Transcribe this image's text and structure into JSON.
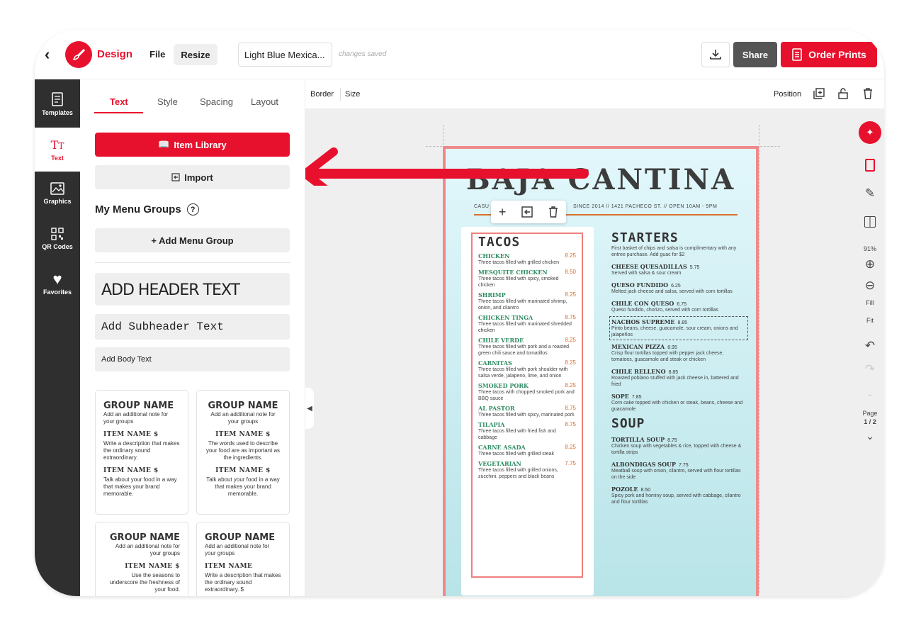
{
  "topbar": {
    "brand": "Design",
    "file": "File",
    "resize": "Resize",
    "doc_title": "Light Blue Mexica...",
    "saved": "changes saved",
    "share": "Share",
    "order": "Order Prints"
  },
  "rail": [
    {
      "label": "Templates",
      "icon": "templates-icon"
    },
    {
      "label": "Text",
      "icon": "text-icon"
    },
    {
      "label": "Graphics",
      "icon": "graphics-icon"
    },
    {
      "label": "QR Codes",
      "icon": "qr-code-icon"
    },
    {
      "label": "Favorites",
      "icon": "heart-icon"
    }
  ],
  "panel": {
    "tabs": [
      "Text",
      "Style",
      "Spacing",
      "Layout"
    ],
    "item_library": "Item Library",
    "import": "Import",
    "my_menu_groups": "My Menu Groups",
    "add_menu_group": "+ Add Menu Group",
    "add_header": "ADD HEADER TEXT",
    "add_subheader": "Add Subheader Text",
    "add_body": "Add Body Text",
    "cards": [
      {
        "group": "GROUP NAME",
        "note": "Add an additional note for your groups",
        "item1": "ITEM NAME $",
        "desc1": "Write a description that makes the ordinary sound extraordinary.",
        "item2": "ITEM NAME $",
        "desc2": "Talk about your food in a way that makes your brand memorable."
      },
      {
        "group": "GROUP NAME",
        "note": "Add an additional note for your groups",
        "item1": "ITEM NAME $",
        "desc1": "The words used to describe your food are as important as the ingredients.",
        "item2": "ITEM NAME $",
        "desc2": "Talk about your food in a way that makes your brand memorable."
      },
      {
        "group": "GROUP NAME",
        "note": "Add an additional note for your groups",
        "item1": "ITEM NAME $",
        "desc1": "Use the seasons to underscore the freshness of your food."
      },
      {
        "group": "GROUP NAME",
        "note": "Add an additional note for your groups",
        "item1": "ITEM NAME",
        "desc1": "Write a description that makes the ordinary sound extraordinary. $"
      }
    ]
  },
  "canvas_bar": {
    "border": "Border",
    "size": "Size",
    "position": "Position"
  },
  "menu": {
    "title": "BAJA CANTINA",
    "subtitle_left": "CASU",
    "subtitle_right": "SINCE 2014 // 1421 PACHECO ST. // OPEN 10AM - 9PM",
    "tacos_title": "TACOS",
    "tacos": [
      {
        "name": "CHICKEN",
        "price": "8.25",
        "desc": "Three tacos filled with grilled chicken"
      },
      {
        "name": "MESQUITE CHICKEN",
        "price": "8.50",
        "desc": "Three tacos filled with spicy, smoked chicken"
      },
      {
        "name": "SHRIMP",
        "price": "8.25",
        "desc": "Three tacos filled with marinated shrimp, onion, and cilantro"
      },
      {
        "name": "CHICKEN TINGA",
        "price": "8.75",
        "desc": "Three tacos filled with marinated shredded chicken"
      },
      {
        "name": "CHILE VERDE",
        "price": "8.25",
        "desc": "Three tacos filled with pork and a roasted green chili sauce and tomatillos"
      },
      {
        "name": "CARNITAS",
        "price": "8.25",
        "desc": "Three tacos filled with pork shoulder with salsa verde, jalapeno, lime, and onion"
      },
      {
        "name": "SMOKED PORK",
        "price": "8.25",
        "desc": "Three tacos with chopped smoked pork and BBQ sauce"
      },
      {
        "name": "AL PASTOR",
        "price": "8.75",
        "desc": "Three tacos filled with spicy, marinated pork"
      },
      {
        "name": "TILAPIA",
        "price": "8.75",
        "desc": "Three tacos filled with fried fish and cabbage"
      },
      {
        "name": "CARNE ASADA",
        "price": "8.25",
        "desc": "Three tacos filled with grilled steak"
      },
      {
        "name": "VEGETARIAN",
        "price": "7.75",
        "desc": "Three tacos filled with grilled onions, zucchini, peppers and black beans"
      }
    ],
    "starters_title": "STARTERS",
    "starters_note": "First basket of chips and salsa is complimentary with any entree purchase. Add guac for $2",
    "starters": [
      {
        "name": "CHEESE QUESADILLAS",
        "price": "5.75",
        "desc": "Served with salsa & sour cream"
      },
      {
        "name": "QUESO FUNDIDO",
        "price": "6.25",
        "desc": "Melted jack cheese and salsa, served with corn tortillas"
      },
      {
        "name": "CHILE CON QUESO",
        "price": "6.75",
        "desc": "Queso fundido, chorizo, served with corn tortillas"
      },
      {
        "name": "NACHOS SUPREME",
        "price": "8.85",
        "desc": "Pinto beans, cheese, guacamole, sour cream, onions and jalapeños"
      },
      {
        "name": "MEXICAN PIZZA",
        "price": "8.95",
        "desc": "Crisp flour tortillas topped with pepper jack cheese, tomatoes, guacamole and steak or chicken"
      },
      {
        "name": "CHILE RELLENO",
        "price": "8.85",
        "desc": "Roasted poblano stuffed with jack cheese in, battered and fried"
      },
      {
        "name": "SOPE",
        "price": "7.85",
        "desc": "Corn cake topped with chicken or steak, beans, cheese and guacamole"
      }
    ],
    "soup_title": "SOUP",
    "soups": [
      {
        "name": "TORTILLA SOUP",
        "price": "8.75",
        "desc": "Chicken soup with vegetables & rice, topped with cheese & tortilla strips"
      },
      {
        "name": "ALBONDIGAS SOUP",
        "price": "7.75",
        "desc": "Meatball soup with onion, cilantro, served with flour tortillas on the side"
      },
      {
        "name": "POZOLE",
        "price": "8.50",
        "desc": "Spicy pork and hominy soup, served with cabbage, cilantro and flour tortillas"
      }
    ]
  },
  "tools": {
    "zoom": "91%",
    "fill": "Fill",
    "fit": "Fit",
    "page_label": "Page",
    "page_num": "1 / 2"
  },
  "colors": {
    "accent": "#e8112d",
    "menu_border": "#f08a8a",
    "taco_name": "#2e8c62",
    "price": "#d8702e"
  }
}
